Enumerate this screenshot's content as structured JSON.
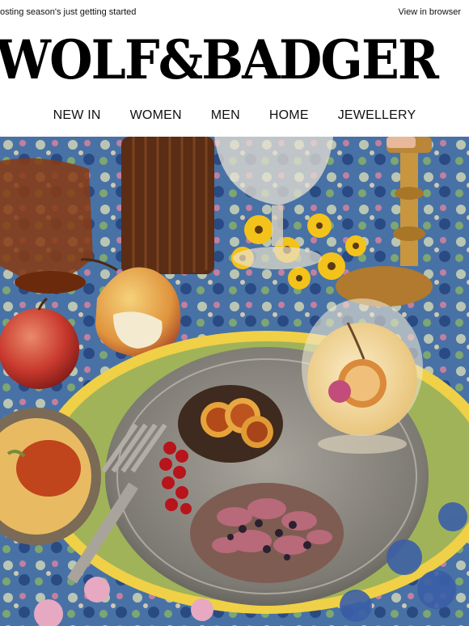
{
  "header": {
    "preheader": "osting season's just getting started",
    "view_in_browser": "View in browser"
  },
  "logo": {
    "text": "WOLF&BADGER"
  },
  "nav": {
    "items": [
      {
        "label": "NEW IN"
      },
      {
        "label": "WOMEN"
      },
      {
        "label": "MEN"
      },
      {
        "label": "HOME"
      },
      {
        "label": "JEWELLERY"
      }
    ]
  },
  "hero": {
    "colors": {
      "tablecloth": "#3a6fb0",
      "plate": "#9a9690",
      "cocktail": "#f1d9a0",
      "flowers": "#f3c21b"
    }
  }
}
